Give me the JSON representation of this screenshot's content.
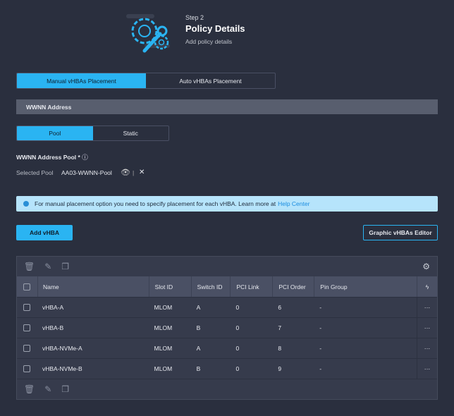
{
  "header": {
    "step": "Step 2",
    "title": "Policy Details",
    "subtitle": "Add policy details"
  },
  "placement_tabs": [
    "Manual vHBAs Placement",
    "Auto vHBAs Placement"
  ],
  "section": "WWNN Address",
  "pool_tabs": [
    "Pool",
    "Static"
  ],
  "pool_label": "WWNN Address Pool *",
  "selected_label": "Selected Pool",
  "selected_value": "AA03-WWNN-Pool",
  "separator": "|",
  "banner": {
    "text": "For manual placement option you need to specify placement for each vHBA. Learn more at",
    "link": "Help Center"
  },
  "buttons": {
    "add": "Add vHBA",
    "graphic": "Graphic vHBAs Editor"
  },
  "table": {
    "columns": [
      "Name",
      "Slot ID",
      "Switch ID",
      "PCI Link",
      "PCI Order",
      "Pin Group"
    ],
    "rows": [
      [
        "vHBA-A",
        "MLOM",
        "A",
        "0",
        "6",
        "-"
      ],
      [
        "vHBA-B",
        "MLOM",
        "B",
        "0",
        "7",
        "-"
      ],
      [
        "vHBA-NVMe-A",
        "MLOM",
        "A",
        "0",
        "8",
        "-"
      ],
      [
        "vHBA-NVMe-B",
        "MLOM",
        "B",
        "0",
        "9",
        "-"
      ]
    ],
    "row_action": "···"
  },
  "colors": {
    "accent": "#2ab4f2",
    "banner": "#b6e4fb"
  }
}
